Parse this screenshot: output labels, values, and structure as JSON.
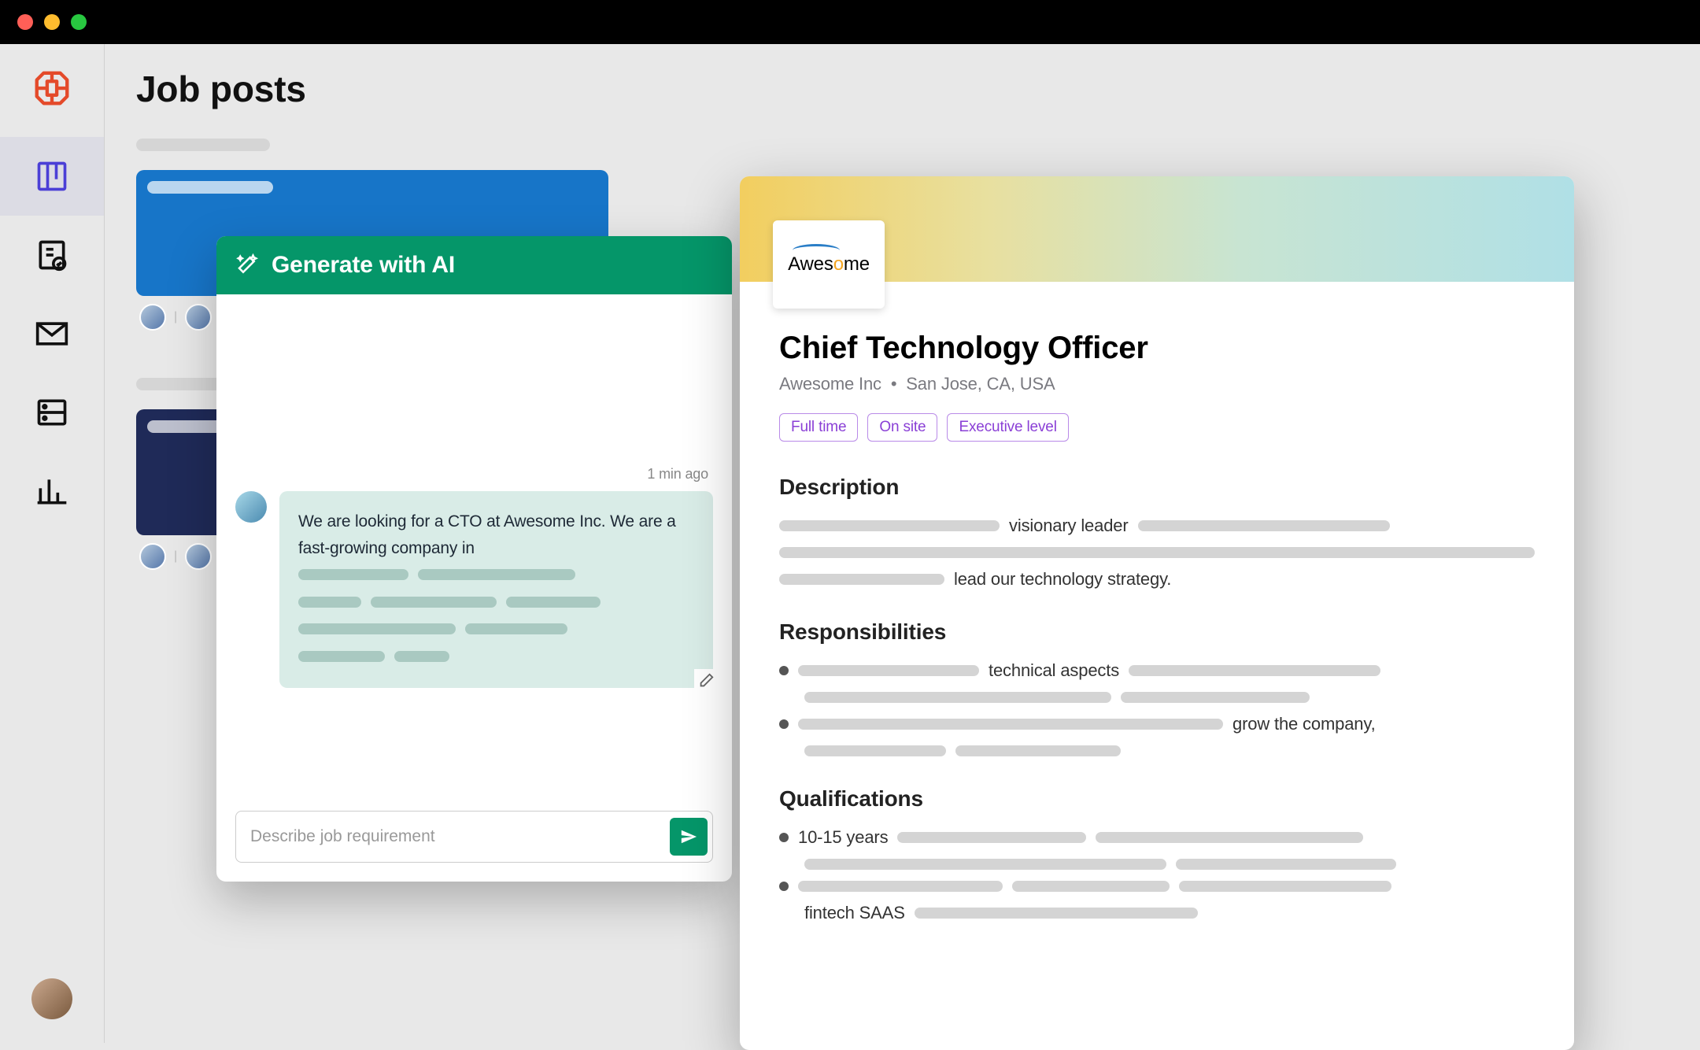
{
  "page": {
    "title": "Job posts"
  },
  "ai_panel": {
    "header": "Generate with AI",
    "timestamp": "1 min ago",
    "message": "We are looking for a CTO at Awesome Inc. We are a fast-growing company in",
    "input_placeholder": "Describe job requirement"
  },
  "job": {
    "company_logo_text_pre": "Awes",
    "company_logo_text_o": "o",
    "company_logo_text_post": "me",
    "title": "Chief Technology Officer",
    "company": "Awesome Inc",
    "meta_separator": "•",
    "location": "San Jose, CA, USA",
    "tags": [
      "Full time",
      "On site",
      "Executive level"
    ],
    "sections": {
      "description": {
        "heading": "Description",
        "kw1": "visionary leader",
        "kw2": "lead our technology strategy."
      },
      "responsibilities": {
        "heading": "Responsibilities",
        "kw1": "technical aspects",
        "kw2": "grow the company,"
      },
      "qualifications": {
        "heading": "Qualifications",
        "kw1": "10-15 years",
        "kw2": "fintech SAAS"
      }
    }
  }
}
